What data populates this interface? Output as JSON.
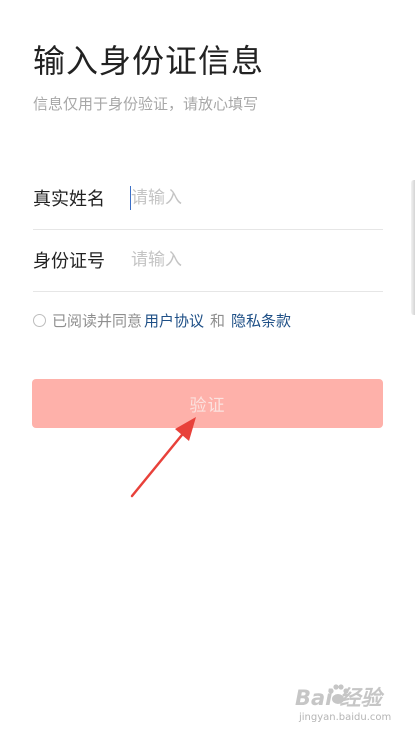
{
  "header": {
    "title": "输入身份证信息",
    "subtitle": "信息仅用于身份验证，请放心填写"
  },
  "form": {
    "name_label": "真实姓名",
    "name_placeholder": "请输入",
    "name_value": "",
    "id_label": "身份证号",
    "id_placeholder": "请输入",
    "id_value": ""
  },
  "agreement": {
    "checked": false,
    "prefix": "已阅读并同意",
    "user_agreement": "用户协议",
    "conjunction": "和",
    "privacy_terms": "隐私条款"
  },
  "actions": {
    "verify_label": "验证"
  },
  "watermark": {
    "logo_text": "Bai 经验",
    "url": "jingyan.baidu.com"
  },
  "colors": {
    "button_bg": "#feb1aa",
    "button_text": "#fbe2df",
    "link": "#1e4f86",
    "arrow": "#e8413a"
  }
}
